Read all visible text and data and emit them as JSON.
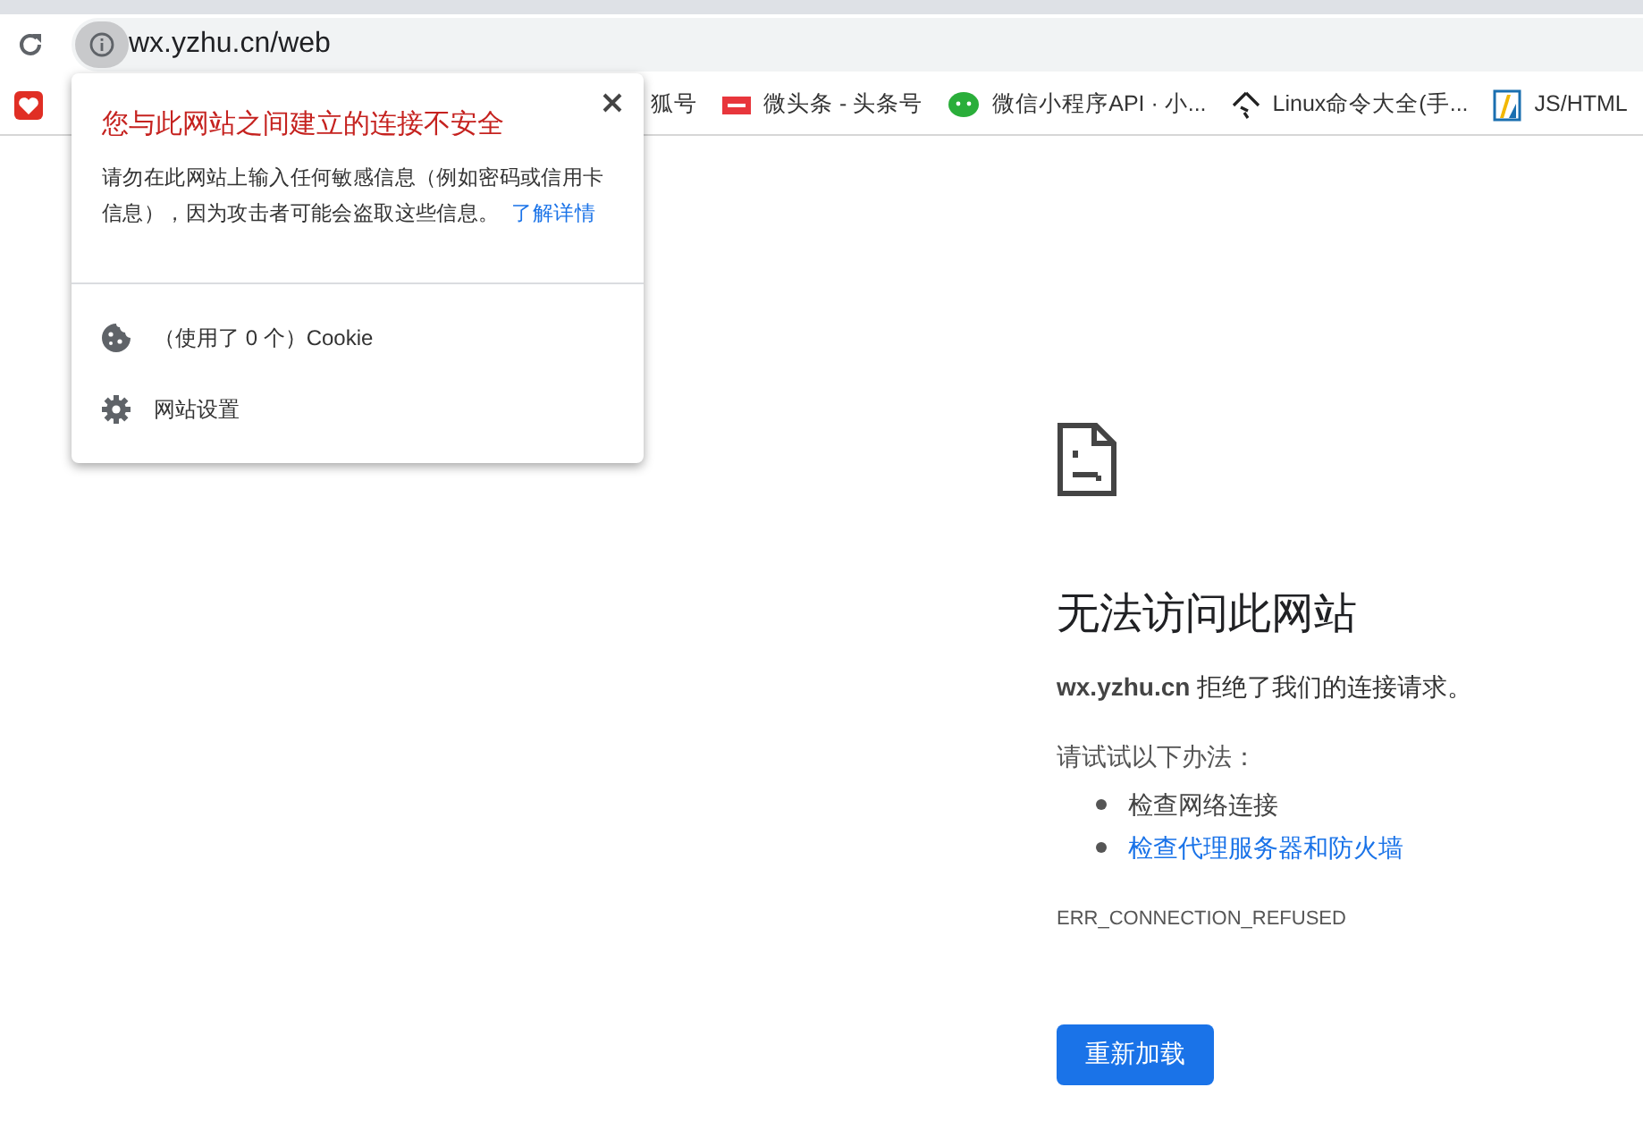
{
  "address_bar": {
    "url": "wx.yzhu.cn/web"
  },
  "bookmarks": [
    {
      "kind": "heart"
    },
    {
      "label": "狐号",
      "kind": "none"
    },
    {
      "label": "微头条 - 头条号",
      "kind": "toutiao"
    },
    {
      "label": "微信小程序API · 小...",
      "kind": "wechat"
    },
    {
      "label": "Linux命令大全(手...",
      "kind": "linux"
    },
    {
      "label": "JS/HTML",
      "kind": "jsfmt"
    }
  ],
  "site_info_popup": {
    "title": "您与此网站之间建立的连接不安全",
    "message": "请勿在此网站上输入任何敏感信息（例如密码或信用卡信息），因为攻击者可能会盗取这些信息。",
    "link": "了解详情",
    "items": [
      {
        "label": "（使用了 0 个）Cookie",
        "kind": "cookie"
      },
      {
        "label": "网站设置",
        "kind": "settings"
      }
    ]
  },
  "error_page": {
    "title": "无法访问此网站",
    "host": "wx.yzhu.cn",
    "message": "拒绝了我们的连接请求。",
    "try_label": "请试试以下办法：",
    "suggestions": [
      {
        "text": "检查网络连接",
        "link": false
      },
      {
        "text": "检查代理服务器和防火墙",
        "link": true
      }
    ],
    "error_code": "ERR_CONNECTION_REFUSED",
    "reload_button": "重新加载"
  }
}
